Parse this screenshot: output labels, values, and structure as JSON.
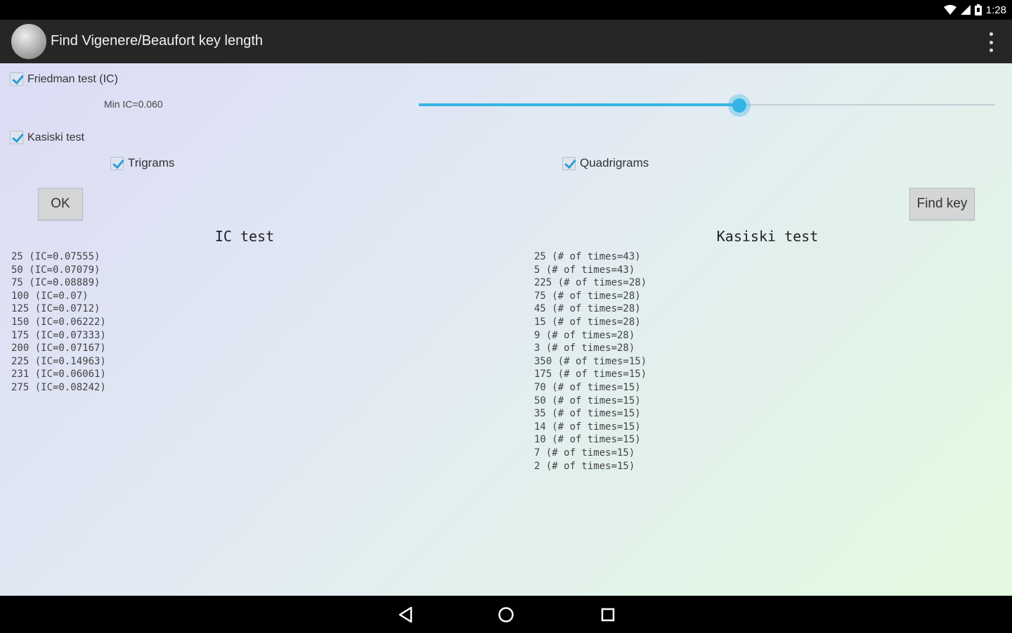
{
  "status": {
    "time": "1:28"
  },
  "app": {
    "title": "Find Vigenere/Beaufort key length"
  },
  "friedman": {
    "label": "Friedman test (IC)",
    "checked": true,
    "min_ic_label": "Min IC=0.060",
    "slider_fraction": 0.556
  },
  "kasiski": {
    "label": "Kasiski test",
    "checked": true
  },
  "trigrams": {
    "label": "Trigrams",
    "checked": true
  },
  "quadrigrams": {
    "label": "Quadrigrams",
    "checked": true
  },
  "buttons": {
    "ok": "OK",
    "find_key": "Find key"
  },
  "ic_results": {
    "title": "IC test",
    "items": [
      "25 (IC=0.07555)",
      "50 (IC=0.07079)",
      "75 (IC=0.08889)",
      "100 (IC=0.07)",
      "125 (IC=0.0712)",
      "150 (IC=0.06222)",
      "175 (IC=0.07333)",
      "200 (IC=0.07167)",
      "225 (IC=0.14963)",
      "231 (IC=0.06061)",
      "275 (IC=0.08242)"
    ]
  },
  "kasiski_results": {
    "title": "Kasiski test",
    "items": [
      "25 (# of times=43)",
      "5 (# of times=43)",
      "225 (# of times=28)",
      "75 (# of times=28)",
      "45 (# of times=28)",
      "15 (# of times=28)",
      "9 (# of times=28)",
      "3 (# of times=28)",
      "350 (# of times=15)",
      "175 (# of times=15)",
      "70 (# of times=15)",
      "50 (# of times=15)",
      "35 (# of times=15)",
      "14 (# of times=15)",
      "10 (# of times=15)",
      "7 (# of times=15)",
      "2 (# of times=15)"
    ]
  },
  "icons": {
    "wifi": "wifi-icon",
    "signal": "signal-icon",
    "battery": "battery-icon",
    "back": "back-icon",
    "home": "home-icon",
    "recents": "recents-icon",
    "overflow": "overflow-menu-icon",
    "app": "app-magnifier-icon"
  },
  "colors": {
    "accent": "#33b5e5",
    "actionbar": "#262626"
  }
}
